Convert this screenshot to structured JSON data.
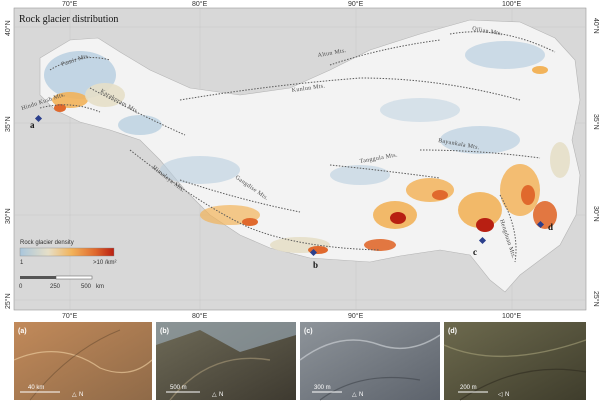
{
  "title": "Rock glacier distribution",
  "longitude_labels_top": [
    "70°E",
    "80°E",
    "90°E",
    "100°E"
  ],
  "longitude_labels_bottom": [
    "70°E",
    "80°E",
    "90°E",
    "100°E"
  ],
  "latitude_labels_left": [
    "40°N",
    "35°N",
    "30°N",
    "25°N"
  ],
  "latitude_labels_right": [
    "40°N",
    "35°N",
    "30°N",
    "25°N"
  ],
  "mountain_ranges": [
    "Altun Mts.",
    "Qilian Mts.",
    "Kunlun Mts.",
    "Hindu Kush Mts.",
    "Karakoram Mts.",
    "Pamir Mts.",
    "Bayankala Mts.",
    "Tanggula Mts.",
    "Gangdise Mts.",
    "Himalaya Mts.",
    "Hengduan Mts."
  ],
  "site_labels": [
    "a",
    "b",
    "c",
    "d"
  ],
  "legend": {
    "title": "Rock glacier density",
    "min_label": "1",
    "max_label": ">10 /km²",
    "colors": [
      "#a9c6dc",
      "#e6dfc8",
      "#f2b35a",
      "#e0692d",
      "#b81f12"
    ]
  },
  "scalebar": {
    "labels": [
      "0",
      "250",
      "500",
      "km"
    ]
  },
  "photo_panels": [
    {
      "letter": "(a)",
      "scale": "40 km",
      "north": "N",
      "colors": [
        "#c28a5a",
        "#8f6a48"
      ]
    },
    {
      "letter": "(b)",
      "scale": "500 m",
      "north": "N",
      "colors": [
        "#6f6b58",
        "#3e3a30"
      ]
    },
    {
      "letter": "(c)",
      "scale": "300 m",
      "north": "N",
      "colors": [
        "#8e949a",
        "#5d636c"
      ]
    },
    {
      "letter": "(d)",
      "scale": "200 m",
      "north": "N",
      "colors": [
        "#6d6a4e",
        "#3f3d2c"
      ]
    }
  ],
  "colors": {
    "frame_background": "#d7d7d7",
    "plateau_fill": "#f2f2f2",
    "range_line": "#5a5a5a",
    "site_marker": "#2b3f8c"
  }
}
